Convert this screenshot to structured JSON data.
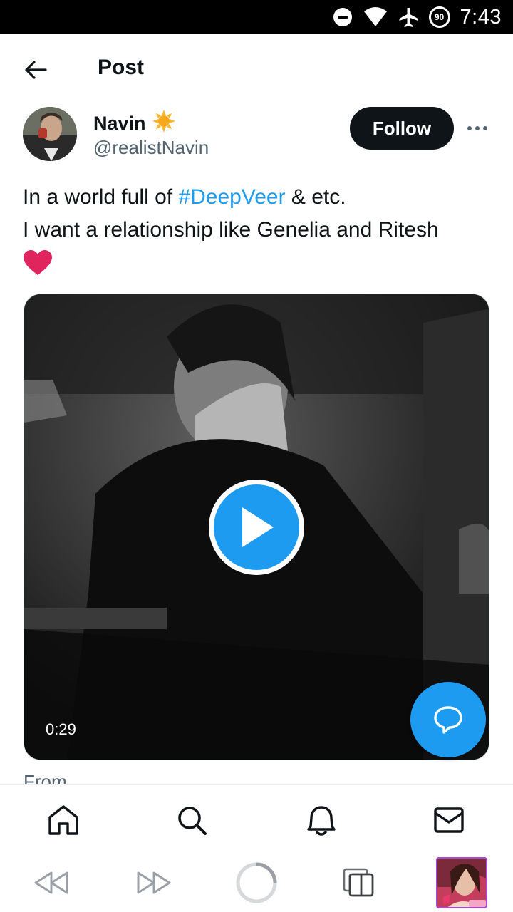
{
  "status_bar": {
    "time": "7:43",
    "battery_level": "90",
    "icons": [
      "do-not-disturb-icon",
      "wifi-icon",
      "airplane-mode-icon",
      "battery-icon"
    ]
  },
  "header": {
    "title": "Post",
    "back_icon": "back-arrow-icon"
  },
  "author": {
    "name": "Navin",
    "handle": "@realistNavin",
    "badge_icon": "sun-emoji-icon",
    "follow_label": "Follow",
    "more_icon": "more-options-icon"
  },
  "tweet": {
    "text_before_tag": "In a world full of ",
    "hashtag": "#DeepVeer",
    "text_after_tag": " & etc.",
    "line2": "I want a relationship like Genelia and Ritesh",
    "emoji_icon": "red-heart-emoji-icon"
  },
  "media": {
    "type": "video",
    "duration": "0:29",
    "play_icon": "play-icon"
  },
  "compose": {
    "icon": "reply-bubble-icon"
  },
  "peek": {
    "text": "From"
  },
  "bottom_nav": {
    "items": [
      {
        "name": "home",
        "icon": "home-icon"
      },
      {
        "name": "search",
        "icon": "search-icon"
      },
      {
        "name": "notifications",
        "icon": "bell-icon"
      },
      {
        "name": "messages",
        "icon": "mail-icon"
      }
    ]
  },
  "browser_bar": {
    "items": [
      "rewind-icon",
      "fast-forward-icon",
      "loading-ring-icon",
      "tabs-icon",
      "profile-thumbnail"
    ]
  },
  "colors": {
    "accent": "#1d9bf0",
    "text": "#0f1419",
    "secondary_text": "#536471",
    "heart": "#e0245e",
    "status_bar": "#000000"
  }
}
